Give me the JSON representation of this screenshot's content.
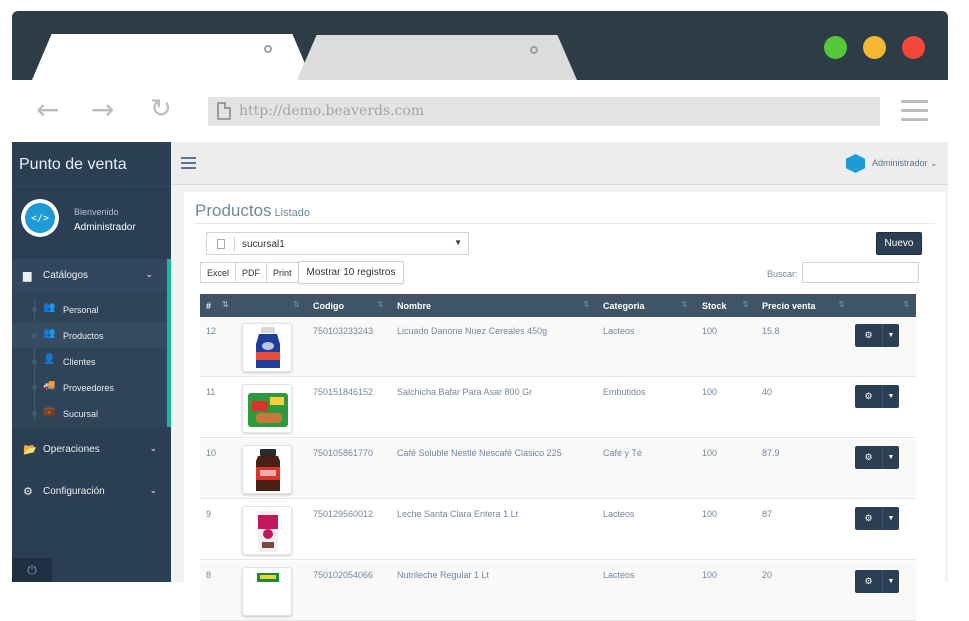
{
  "browser": {
    "url": "http://demo.beaverds.com",
    "traffic_colors": [
      "#57c73a",
      "#f5b833",
      "#f2473a"
    ]
  },
  "sidebar": {
    "brand": "Punto de venta",
    "welcome": "Bienvenido",
    "user": "Administrador",
    "sections": [
      {
        "label": "Catálogos",
        "icon": "book-icon"
      },
      {
        "label": "Operaciones",
        "icon": "folder-open-icon"
      },
      {
        "label": "Configuración",
        "icon": "cogs-icon"
      }
    ],
    "catalog_items": [
      {
        "label": "Personal",
        "icon": "users-icon"
      },
      {
        "label": "Productos",
        "icon": "users-icon"
      },
      {
        "label": "Clientes",
        "icon": "user-icon"
      },
      {
        "label": "Proveedores",
        "icon": "truck-icon"
      },
      {
        "label": "Sucursal",
        "icon": "briefcase-icon"
      }
    ]
  },
  "topbar": {
    "user": "Administrador"
  },
  "panel": {
    "title": "Productos",
    "subtitle": "Listado",
    "branch": "sucursal1",
    "new_label": "Nuevo",
    "export_buttons": [
      "Excel",
      "PDF",
      "Print"
    ],
    "rows_label": "Mostrar 10 registros",
    "search_label": "Buscar:",
    "search_value": ""
  },
  "table": {
    "columns": [
      "#",
      "Codigo",
      "Nombre",
      "Categoria",
      "Stock",
      "Precio venta"
    ],
    "rows": [
      {
        "id": "12",
        "code": "750103233243",
        "name": "Licuado Danone Nuez Cereales 450g",
        "category": "Lacteos",
        "stock": "100",
        "price": "15.8",
        "image": "yogurt-bottle"
      },
      {
        "id": "11",
        "code": "750151846152",
        "name": "Salchicha Bafar Para Asar 800 Gr",
        "category": "Embutidos",
        "stock": "100",
        "price": "40",
        "image": "sausage-pack"
      },
      {
        "id": "10",
        "code": "750105861770",
        "name": "Café Soluble Nestlé Nescafé Clasico 225",
        "category": "Café y Té",
        "stock": "100",
        "price": "87.9",
        "image": "coffee-jar"
      },
      {
        "id": "9",
        "code": "750129560012",
        "name": "Leche Santa Clara Entera 1 Lt",
        "category": "Lacteos",
        "stock": "100",
        "price": "87",
        "image": "milk-carton"
      },
      {
        "id": "8",
        "code": "750102054066",
        "name": "Nutrileche Regular 1 Lt",
        "category": "Lacteos",
        "stock": "100",
        "price": "20",
        "image": "milk-carton-green"
      }
    ]
  }
}
